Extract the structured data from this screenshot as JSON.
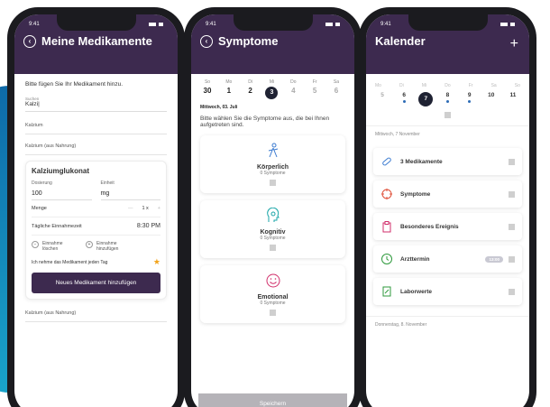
{
  "phone1": {
    "time": "9:41",
    "title": "Meine Medikamente",
    "intro": "Bitte fügen Sie Ihr Medikament hinzu.",
    "search_label": "Suchen",
    "search_value": "Kalzi|",
    "field1": "Kalzium",
    "field2": "Kalzium (aus Nahrung)",
    "card_title": "Kalziumglukonat",
    "dosierung_label": "Dosierung",
    "dosierung_value": "100",
    "einheit_label": "Einheit",
    "einheit_value": "mg",
    "menge_label": "Menge",
    "menge_minus": "—",
    "menge_value": "1 x",
    "menge_plus": "+",
    "zeit_label": "Tägliche Einnahmezeit",
    "zeit_value": "8:30 PM",
    "delete_label": "Einnahme löschen",
    "add_label": "Einnahme hinzufügen",
    "daily_label": "Ich nehme das Medikament jeden Tag",
    "button": "Neues Medikament hinzufügen",
    "footer_field": "Kalzium (aus Nahrung)"
  },
  "phone2": {
    "time": "9:41",
    "title": "Symptome",
    "weekdays": [
      "So",
      "Mo",
      "Di",
      "Mi",
      "Do",
      "Fr",
      "Sa"
    ],
    "days": [
      "30",
      "1",
      "2",
      "3",
      "4",
      "5",
      "6"
    ],
    "date_label": "Mittwoch, 03. Juli",
    "intro": "Bitte wählen Sie die Symptome aus, die bei Ihnen aufgetreten sind.",
    "cards": [
      {
        "name": "Körperlich",
        "count": "0 Symptome"
      },
      {
        "name": "Kognitiv",
        "count": "0 Symptome"
      },
      {
        "name": "Emotional",
        "count": "0 Symptome"
      }
    ],
    "save": "Speichern"
  },
  "phone3": {
    "time": "9:41",
    "title": "Kalender",
    "plus": "+",
    "weekdays": [
      "Mo",
      "Di",
      "Mi",
      "Do",
      "Fr",
      "Sa",
      "So"
    ],
    "days": [
      "5",
      "6",
      "7",
      "8",
      "9",
      "10",
      "11"
    ],
    "section1": "Mittwoch, 7 November",
    "items": [
      {
        "label": "3 Medikamente",
        "color": "#3b7bd0"
      },
      {
        "label": "Symptome",
        "color": "#e0523b"
      },
      {
        "label": "Besonderes Ereignis",
        "color": "#d12f6b"
      },
      {
        "label": "Arzttermin",
        "color": "#2f9a3d"
      },
      {
        "label": "Laborwerte",
        "color": "#2f9a3d"
      }
    ],
    "arzt_pill": "13:00",
    "section2": "Donnerstag, 8. November"
  }
}
